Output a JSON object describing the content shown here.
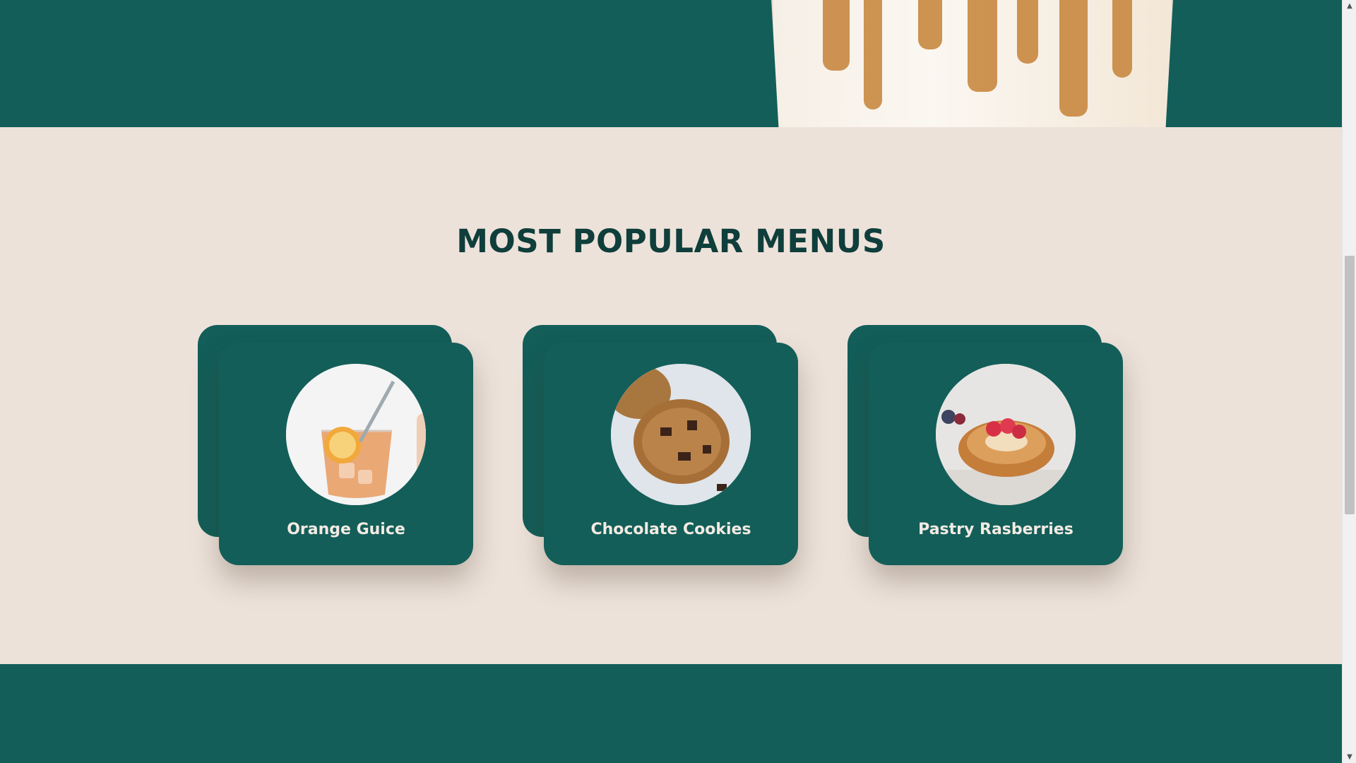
{
  "section": {
    "title": "MOST POPULAR MENUS"
  },
  "menu_items": [
    {
      "label": "Orange Guice"
    },
    {
      "label": "Chocolate Cookies"
    },
    {
      "label": "Pastry Rasberries"
    }
  ],
  "colors": {
    "primary": "#135e59",
    "background": "#ede2da",
    "title": "#0f3e3b",
    "card_text": "#f3ebe3"
  },
  "icons": {
    "scroll_up": "triangle-up-icon",
    "scroll_down": "triangle-down-icon"
  }
}
